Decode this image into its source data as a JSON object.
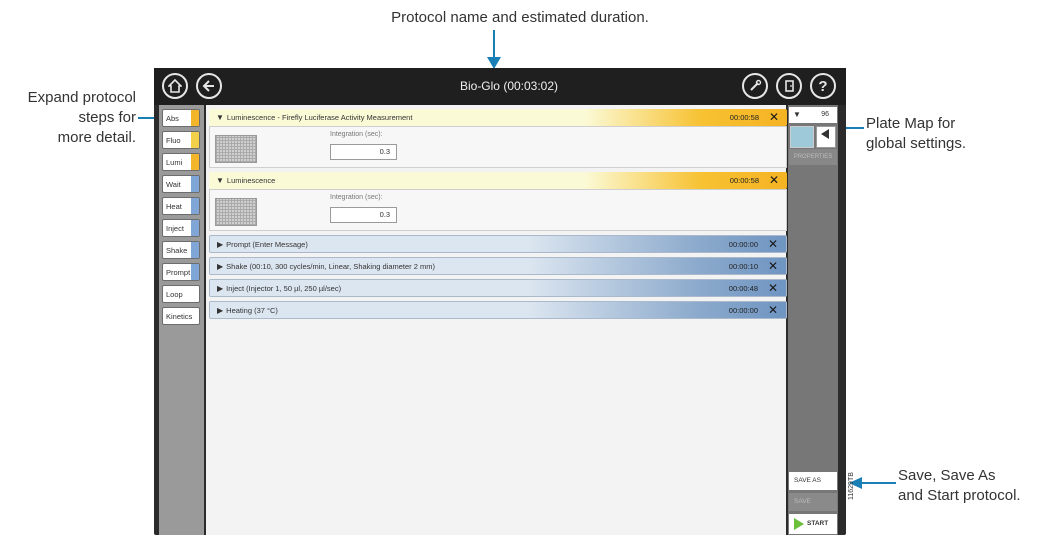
{
  "callouts": {
    "top": "Protocol name and estimated duration.",
    "left_lines": [
      "Expand protocol",
      "steps for",
      "more detail."
    ],
    "plate_lines": [
      "Plate Map for",
      "global settings."
    ],
    "save_lines": [
      "Save, Save As",
      "and Start protocol."
    ]
  },
  "app": {
    "title": "Bio-Glo (00:03:02)"
  },
  "icons": {
    "home": "home-icon",
    "back": "back-arrow-icon",
    "settings": "wrench-icon",
    "exit": "exit-door-icon",
    "help": "help-icon"
  },
  "sidebar": {
    "items": [
      {
        "label": "Abs",
        "accent": "#f3b62a"
      },
      {
        "label": "Fluo",
        "accent": "#f3d04a"
      },
      {
        "label": "Lumi",
        "accent": "#f3b62a"
      },
      {
        "label": "Wait",
        "accent": "#7fa6d6"
      },
      {
        "label": "Heat",
        "accent": "#7fa6d6"
      },
      {
        "label": "Inject",
        "accent": "#7fa6d6"
      },
      {
        "label": "Shake",
        "accent": "#7fa6d6"
      },
      {
        "label": "Prompt",
        "accent": "#7fa6d6"
      },
      {
        "label": "Loop",
        "accent": ""
      },
      {
        "label": "Kinetics",
        "accent": ""
      }
    ]
  },
  "steps": {
    "lumi1": {
      "title": "Luminescence - Firefly Luciferase Activity Measurement",
      "time": "00:00:58",
      "int_label": "Integration (sec):",
      "int_value": "0.3"
    },
    "lumi2": {
      "title": "Luminescence",
      "time": "00:00:58",
      "int_label": "Integration (sec):",
      "int_value": "0.3"
    },
    "prompt": {
      "title": "Prompt  (Enter Message)",
      "time": "00:00:00"
    },
    "shake": {
      "title": "Shake  (00:10, 300 cycles/min, Linear, Shaking diameter 2 mm)",
      "time": "00:00:10"
    },
    "inject": {
      "title": "Inject  (Injector 1, 50 µl, 250 µl/sec)",
      "time": "00:00:48"
    },
    "heating": {
      "title": "Heating  (37 °C)",
      "time": "00:00:00"
    },
    "close_glyph": "✕",
    "collapsed_glyph": "▶",
    "expanded_glyph": "▼"
  },
  "right_panel": {
    "plate_value": "96",
    "plate_dropdown_glyph": "▼",
    "properties_label": "PROPERTIES",
    "save_as_label": "SAVE AS",
    "save_label": "SAVE",
    "start_label": "START"
  },
  "figure_code": "11629TB",
  "colors": {
    "luminescence_accent": "#f5b323",
    "blue_step_accent": "#6f95c2",
    "callout_arrow": "#1a7fb5"
  }
}
